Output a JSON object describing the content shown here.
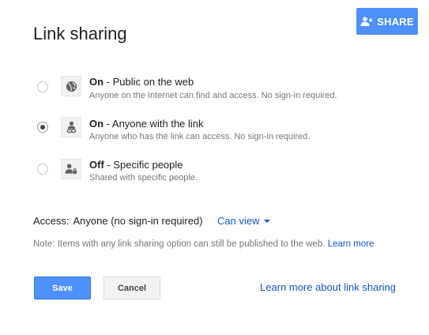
{
  "share_button": {
    "label": "SHARE",
    "icon": "person-add-icon"
  },
  "title": "Link sharing",
  "options": [
    {
      "state": "On",
      "title": "Public on the web",
      "desc": "Anyone on the Internet can find and access. No sign-in required.",
      "icon": "globe-icon",
      "selected": false
    },
    {
      "state": "On",
      "title": "Anyone with the link",
      "desc": "Anyone who has the link can access. No sign-in required.",
      "icon": "person-link-icon",
      "selected": true
    },
    {
      "state": "Off",
      "title": "Specific people",
      "desc": "Shared with specific people.",
      "icon": "person-lock-icon",
      "selected": false
    }
  ],
  "access": {
    "label": "Access:",
    "value": "Anyone (no sign-in required)",
    "permission": "Can view"
  },
  "note": {
    "text": "Note: Items with any link sharing option can still be published to the web.",
    "link": "Learn more"
  },
  "buttons": {
    "save": "Save",
    "cancel": "Cancel"
  },
  "learn_more_sharing": "Learn more about link sharing",
  "colors": {
    "accent": "#4d90fe",
    "link": "#1155cc"
  }
}
